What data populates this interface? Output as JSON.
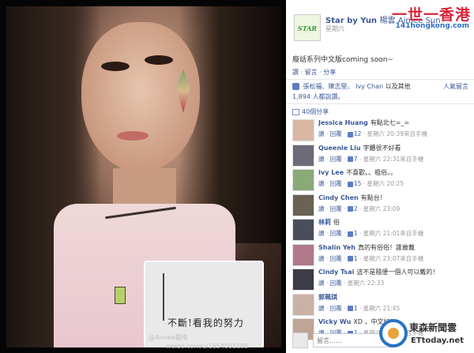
{
  "photo": {
    "inset_text": "不斷!看我的努力",
    "watermark_line1": "@Aimee楊晴",
    "watermark_line2": "weibo.com/u/1654001185"
  },
  "page": {
    "avatar_text": "STAR",
    "name": "Star by Yun",
    "name_suffix": "楊雲 Aimee Sun",
    "post_time": "星期六",
    "logo_big": "一世一香港",
    "logo_small": "141hongkong.com",
    "post_text": "廢話系列中文版coming soon~",
    "actions": "讚 · 留言 · 分享"
  },
  "likes": {
    "prefix": "",
    "names": "張松福、陳志堅、",
    "ivy": "Ivy Chan",
    "suffix": "以及其他",
    "count_line": "1,894 人都說讚。",
    "sort": "人氣留言"
  },
  "shares": {
    "label": "40個分享"
  },
  "comments": [
    {
      "name": "Jessica Huang",
      "text": "有點北七=_=",
      "likes": "12",
      "time": "星期六 20:39",
      "via": "來自手機",
      "avatar_color": "#d9b7a3"
    },
    {
      "name": "Queenie Liu",
      "text": "字體很不好看",
      "likes": "7",
      "time": "星期六 22:31",
      "via": "來自手機",
      "avatar_color": "#6d6a7a"
    },
    {
      "name": "Ivy Lee",
      "text": "不喜歡。。粗俗。。",
      "likes": "15",
      "time": "星期六 20:25",
      "via": "",
      "avatar_color": "#8aaa78"
    },
    {
      "name": "Cindy Chen",
      "text": "有點台！",
      "likes": "2",
      "time": "星期六 23:09",
      "via": "",
      "avatar_color": "#6a6254"
    },
    {
      "name": "林莉",
      "text": "俗",
      "likes": "1",
      "time": "星期六 21:01",
      "via": "來自手機",
      "avatar_color": "#4a4e5a"
    },
    {
      "name": "Shalin Yeh",
      "text": "真的有俗俗！誰敢戴",
      "likes": "1",
      "time": "星期六 23:07",
      "via": "來自手機",
      "avatar_color": "#b07a8a"
    },
    {
      "name": "Cindy Tsai",
      "text": "這不是隨便一個人可以戴的！",
      "likes": "",
      "time": "星期六 22:33",
      "via": "",
      "avatar_color": "#3c3c48"
    },
    {
      "name": "郭珮琪",
      "text": "",
      "likes": "1",
      "time": "星期六 21:45",
      "via": "",
      "avatar_color": "#c9b2a5"
    },
    {
      "name": "Vicky Wu",
      "text": "XD ，中文好！",
      "likes": "1",
      "time": "星期六 23:52",
      "via": "來自手機",
      "avatar_color": "#bfa497"
    }
  ],
  "labels": {
    "like": "讚",
    "reply": "回覆",
    "comment_placeholder": "留言……"
  },
  "ettoday": {
    "cn": "東森新聞雲",
    "en": "ETtoday.net"
  }
}
